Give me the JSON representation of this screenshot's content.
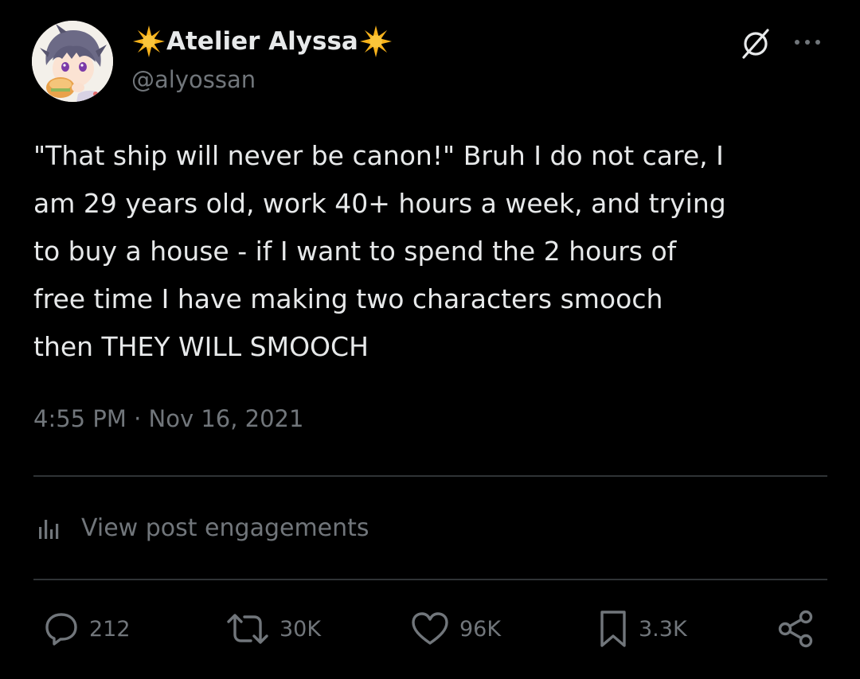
{
  "author": {
    "display_name": "Atelier Alyssa",
    "handle": "@alyossan",
    "name_emoji": "glowing-star-emoji"
  },
  "post": {
    "lines": [
      "\"That ship will never be canon!\" Bruh I do not care, I",
      "am 29 years old, work 40+ hours a week, and trying",
      "to buy a house - if I want to spend the 2 hours of",
      "free time I have making two characters smooch",
      "then THEY WILL SMOOCH"
    ],
    "timestamp": "4:55 PM · Nov 16, 2021"
  },
  "engagements_link": {
    "label": "View post engagements",
    "icon": "analytics-icon"
  },
  "actions": {
    "reply": {
      "icon": "reply-icon",
      "count": "212"
    },
    "repost": {
      "icon": "repost-icon",
      "count": "30K"
    },
    "like": {
      "icon": "heart-icon",
      "count": "96K"
    },
    "bookmark": {
      "icon": "bookmark-icon",
      "count": "3.3K"
    },
    "share": {
      "icon": "share-icon"
    }
  },
  "header_icons": {
    "grok": "grok-icon",
    "more": "more-icon"
  },
  "colors": {
    "background": "#000000",
    "primary_text": "#e7e9ea",
    "secondary_text": "#71767b",
    "divider": "#2f3336",
    "emoji_sun": "#f7b21b"
  }
}
